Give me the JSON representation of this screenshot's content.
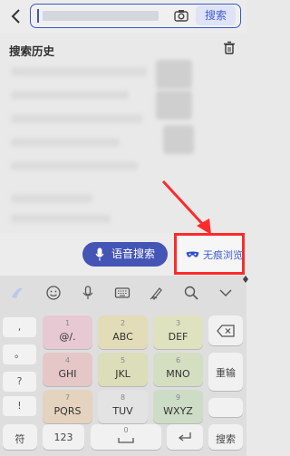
{
  "header": {
    "search_button": "搜索"
  },
  "history": {
    "title": "搜索历史"
  },
  "actions": {
    "voice_search": "语音搜索",
    "incognito": "无痕浏览"
  },
  "keyboard": {
    "side_keys": [
      ",",
      "。",
      "?",
      "!"
    ],
    "keys": [
      {
        "num": "1",
        "letters": "@/.",
        "color": "#e6c9d2"
      },
      {
        "num": "2",
        "letters": "ABC",
        "color": "#e2dcb8"
      },
      {
        "num": "3",
        "letters": "DEF",
        "color": "#dfe2bf"
      },
      {
        "num": "4",
        "letters": "GHI",
        "color": "#e6c7c7"
      },
      {
        "num": "5",
        "letters": "JKL",
        "color": "#dcddb9"
      },
      {
        "num": "6",
        "letters": "MNO",
        "color": "#d4dfc1"
      },
      {
        "num": "7",
        "letters": "PQRS",
        "color": "#e4d3bf"
      },
      {
        "num": "8",
        "letters": "TUV",
        "color": "#e3e3e3"
      },
      {
        "num": "9",
        "letters": "WXYZ",
        "color": "#cddcc6"
      }
    ],
    "reenter": "重输",
    "symbol": "符",
    "num_switch": "123",
    "zero": "0",
    "search": "搜索"
  }
}
